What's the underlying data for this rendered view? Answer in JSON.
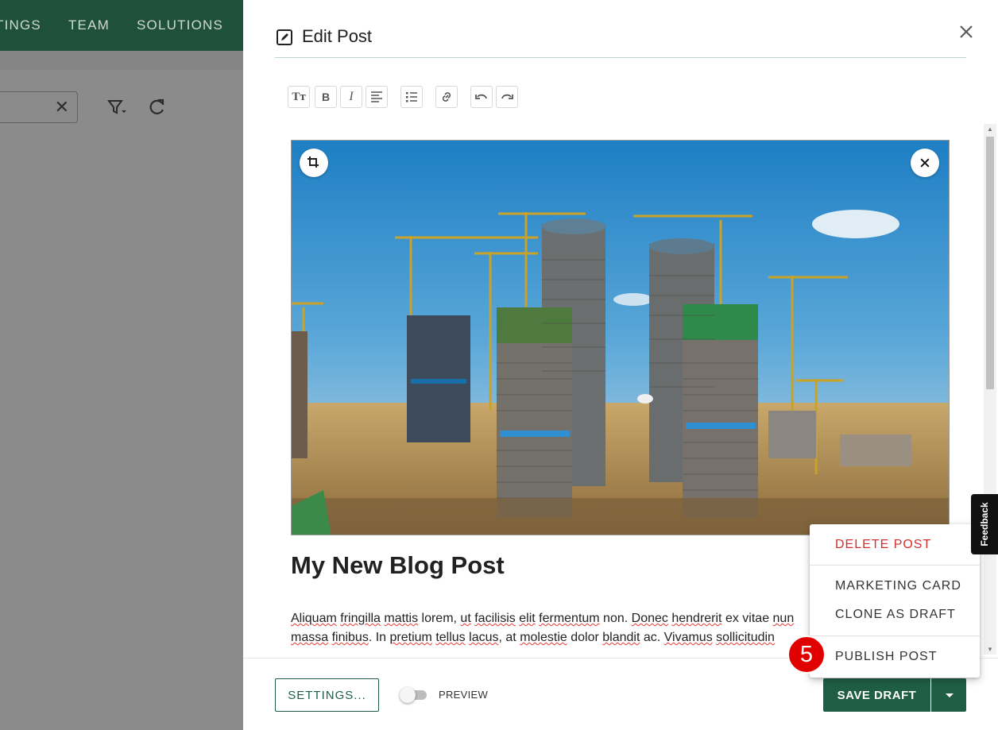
{
  "background_app": {
    "nav": [
      "TINGS",
      "TEAM",
      "SOLUTIONS"
    ],
    "clear_search_label": "✕"
  },
  "drawer": {
    "title": "Edit Post",
    "post_title": "My New Blog Post",
    "post_body": {
      "line1": [
        "",
        "Aliquam",
        " ",
        "fringilla",
        " ",
        "mattis",
        " lorem, ",
        "ut",
        " ",
        "facilisis",
        " ",
        "elit",
        " ",
        "fermentum",
        " non. ",
        "Donec",
        " ",
        "hendrerit",
        " ex vitae ",
        "nun"
      ],
      "line2": [
        "",
        "massa",
        " ",
        "finibus",
        ". In ",
        "pretium",
        " ",
        "tellus",
        " ",
        "lacus",
        ", at ",
        "molestie",
        " dolor ",
        "blandit",
        " ac. ",
        "Vivamus",
        " ",
        "sollicitudin"
      ]
    }
  },
  "toolbar": {
    "text_size_label": "Tт",
    "bold_label": "B",
    "italic_label": "I"
  },
  "footer": {
    "settings_label": "SETTINGS...",
    "preview_label": "PREVIEW",
    "preview_on": false,
    "save_label": "SAVE DRAFT"
  },
  "menu": {
    "delete": "DELETE POST",
    "marketing": "MARKETING CARD",
    "clone": "CLONE AS DRAFT",
    "publish": "PUBLISH POST"
  },
  "step_badge": "5",
  "feedback_label": "Feedback",
  "colors": {
    "primary": "#1f5e44",
    "danger": "#d32f2f",
    "badge": "#e00000"
  }
}
